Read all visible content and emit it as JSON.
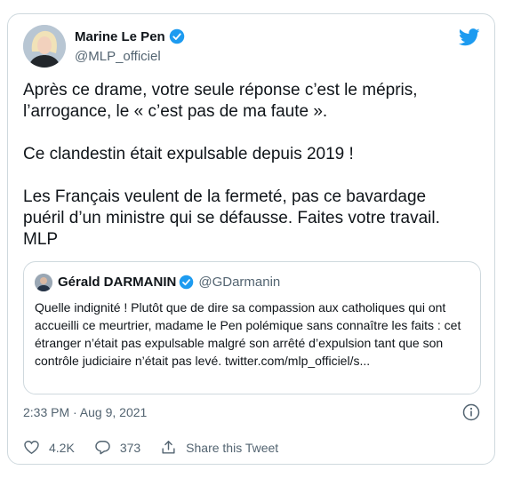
{
  "tweet": {
    "author_name": "Marine Le Pen",
    "author_handle": "@MLP_officiel",
    "text": "Après ce drame, votre seule réponse c’est le mépris,\nl’arrogance, le « c’est pas de ma faute ».\n\nCe clandestin était expulsable depuis 2019 !\n\nLes Français veulent de la fermeté, pas ce bavardage\npuéril d’un ministre qui se défausse. Faites votre travail.\nMLP",
    "timestamp": "2:33 PM · Aug 9, 2021"
  },
  "quoted": {
    "author_name": "Gérald DARMANIN",
    "author_handle": "@GDarmanin",
    "text": "Quelle indignité ! Plutôt que de dire sa compassion aux catholiques qui ont accueilli ce meurtrier, madame le Pen polémique sans connaître les faits : cet étranger n’était pas expulsable malgré son arrêté d’expulsion tant que son contrôle judiciaire n’était pas levé. twitter.com/mlp_officiel/s..."
  },
  "actions": {
    "likes": "4.2K",
    "replies": "373",
    "share_label": "Share this Tweet"
  },
  "icons": {
    "brand": "twitter-bird-icon",
    "verified": "verified-badge-icon",
    "info": "info-icon",
    "like": "heart-icon",
    "reply": "reply-bubble-icon",
    "share": "share-icon"
  },
  "colors": {
    "twitter_blue": "#1d9bf0",
    "text": "#0f1419",
    "muted": "#536471",
    "border": "#cfd9de"
  }
}
